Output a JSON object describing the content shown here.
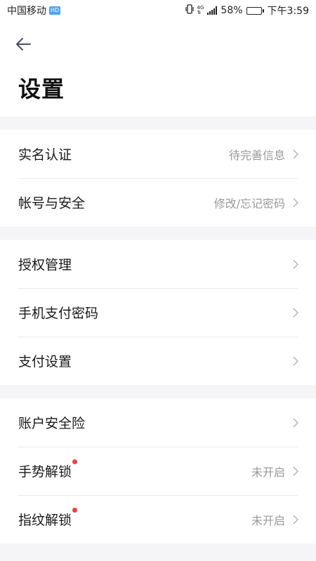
{
  "status_bar": {
    "carrier": "中国移动",
    "hd_badge": "HD",
    "network": "4G",
    "battery": "58%",
    "battery_level": 0.58,
    "time": "下午3:59"
  },
  "header": {
    "back_icon": "arrow-left-icon",
    "title": "设置"
  },
  "groups": [
    {
      "items": [
        {
          "label": "实名认证",
          "value": "待完善信息"
        },
        {
          "label": "帐号与安全",
          "value": "修改/忘记密码"
        }
      ]
    },
    {
      "items": [
        {
          "label": "授权管理",
          "value": ""
        },
        {
          "label": "手机支付密码",
          "value": ""
        },
        {
          "label": "支付设置",
          "value": ""
        }
      ]
    },
    {
      "items": [
        {
          "label": "账户安全险",
          "value": ""
        },
        {
          "label": "手势解锁",
          "value": "未开启",
          "red_dot": true
        },
        {
          "label": "指纹解锁",
          "value": "未开启",
          "red_dot": true
        }
      ]
    }
  ],
  "colors": {
    "background": "#f5f5f7",
    "card": "#ffffff",
    "red_dot": "#f04040",
    "secondary_text": "#9a9a9a"
  }
}
